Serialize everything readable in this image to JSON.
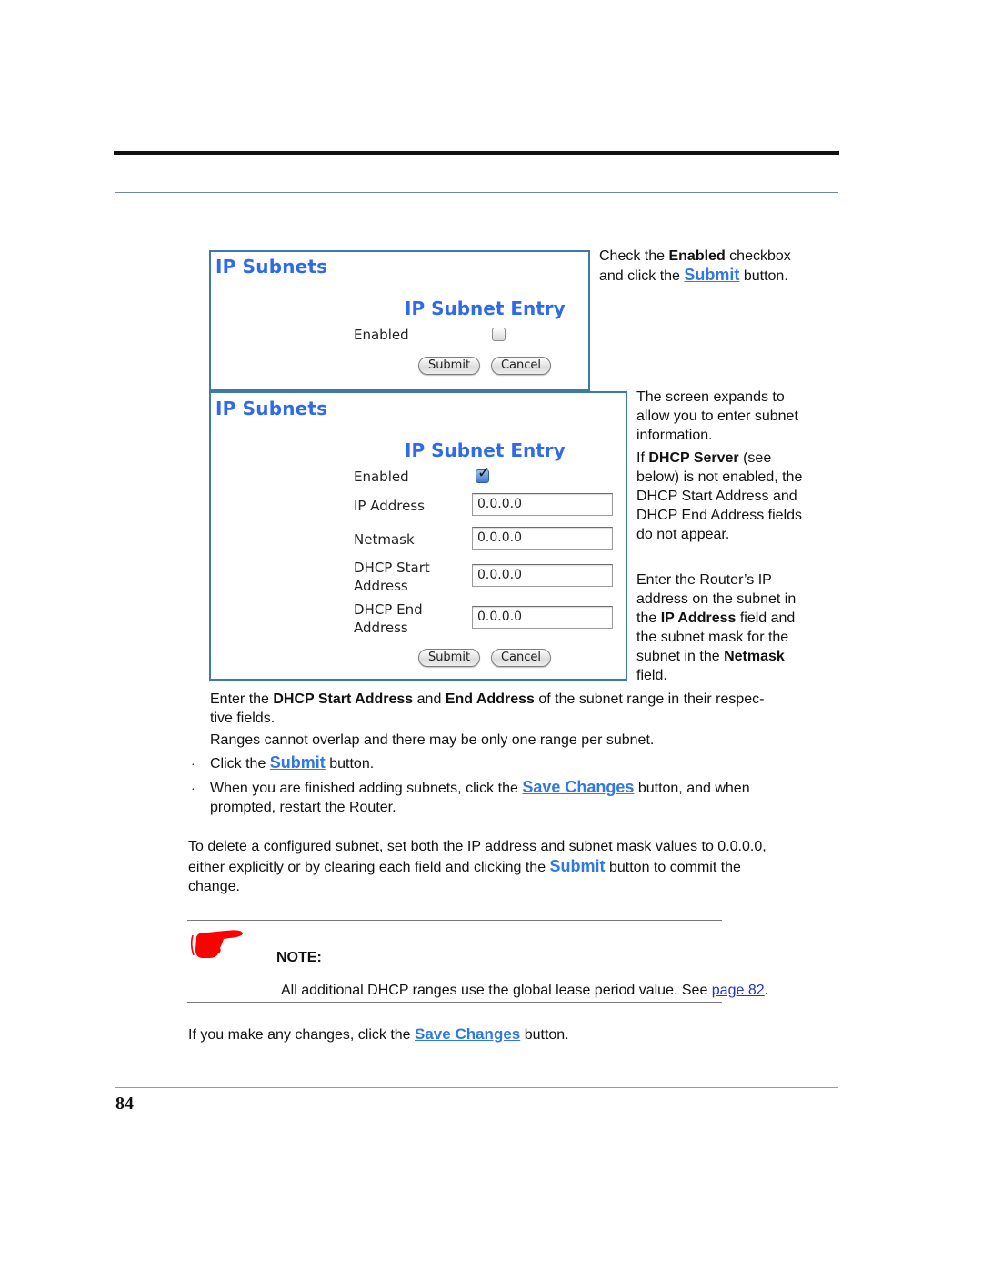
{
  "page": {
    "page_number": "84"
  },
  "panel1": {
    "title": "IP Subnets",
    "section": "IP Subnet Entry",
    "enabled_label": "Enabled",
    "enabled_checked": false,
    "submit_label": "Submit",
    "cancel_label": "Cancel"
  },
  "panel2": {
    "title": "IP Subnets",
    "section": "IP Subnet Entry",
    "enabled_label": "Enabled",
    "enabled_checked": true,
    "checkmark": "✓",
    "fields": [
      {
        "label": "IP Address",
        "value": "0.0.0.0"
      },
      {
        "label": "Netmask",
        "value": "0.0.0.0"
      },
      {
        "label_line1": "DHCP Start",
        "label_line2": "Address",
        "value": "0.0.0.0"
      },
      {
        "label_line1": "DHCP End",
        "label_line2": "Address",
        "value": "0.0.0.0"
      }
    ],
    "submit_label": "Submit",
    "cancel_label": "Cancel"
  },
  "side1": {
    "t1": "Check the ",
    "b1": "Enabled",
    "t2": " checkbox",
    "t3": "and click the ",
    "link": "Submit",
    "t4": " button."
  },
  "side2": {
    "p1": [
      "The screen expands to",
      "allow you to enter subnet",
      "information."
    ],
    "p2_t1": "If ",
    "p2_b1": "DHCP Server",
    "p2_t2": " (see",
    "p2_lines": [
      "below) is not enabled, the",
      "DHCP Start Address and",
      "DHCP End Address fields",
      "do not appear."
    ]
  },
  "side3": {
    "l1": "Enter the Router’s IP",
    "l2": "address on the subnet in",
    "l3_t1": "the ",
    "l3_b": "IP Address",
    "l3_t2": " field and",
    "l4": "the subnet mask for the",
    "l5_t1": "subnet in the ",
    "l5_b": "Netmask",
    "l6": "field."
  },
  "body": {
    "p1_t1": "Enter the ",
    "p1_b1": "DHCP Start Address",
    "p1_t2": " and ",
    "p1_b2": "End Address",
    "p1_t3": " of the subnet range in their respec-",
    "p1_l2": "tive fields.",
    "p2": "Ranges cannot overlap and there may be only one range per subnet.",
    "bullet_glyph": "·",
    "b1_t1": "Click the ",
    "b1_link": "Submit",
    "b1_t2": " button.",
    "b2_t1": "When you are finished adding subnets, click the ",
    "b2_link": "Save Changes",
    "b2_t2": " button, and when",
    "b2_l2": "prompted, restart the Router.",
    "del_l1": "To delete a configured subnet, set both the IP address and subnet mask values to 0.0.0.0,",
    "del_l2_t1": "either explicitly or by clearing each field and clicking the ",
    "del_l2_link": "Submit",
    "del_l2_t2": " button to commit the",
    "del_l3": "change."
  },
  "note": {
    "label": "NOTE:",
    "text": "All additional DHCP ranges use the global lease period value. See ",
    "link": "page 82",
    "end": "."
  },
  "final": {
    "t1": "If you make any changes, click the ",
    "link": "Save Changes",
    "t2": " button."
  },
  "colors": {
    "panel_title": "#2f6be8",
    "panel_border": "#3d7aa8",
    "link": "#2f78e6",
    "note_hand": "#ff0000"
  }
}
